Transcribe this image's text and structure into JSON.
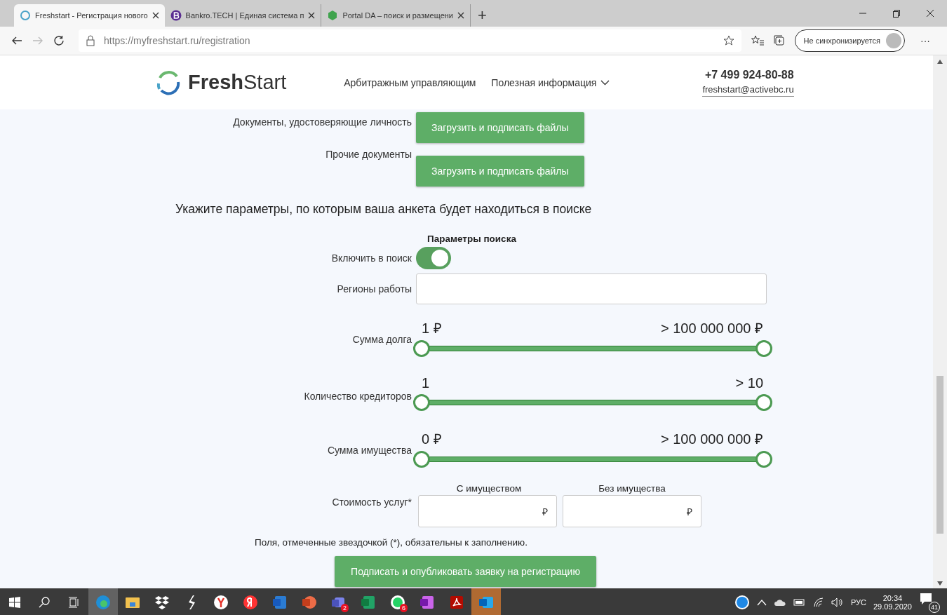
{
  "browser": {
    "tabs": [
      {
        "kind": "freshstart",
        "title": "Freshstart - Регистрация нового",
        "selected": true
      },
      {
        "kind": "bankro",
        "title": "Bankro.TECH | Единая система п",
        "selected": false
      },
      {
        "kind": "portal",
        "title": "Portal DA – поиск и размещени",
        "selected": false
      }
    ],
    "new_tab": "+",
    "url_host": "https://myfreshstart.ru",
    "url_path": "/registration",
    "profile_button": "Не синхронизируется",
    "more": "···"
  },
  "site_header": {
    "logo_bold": "Fresh",
    "logo_light": "Start",
    "nav": [
      {
        "label": "Арбитражным управляющим",
        "dropdown": false
      },
      {
        "label": "Полезная информация",
        "dropdown": true
      }
    ],
    "phone": "+7 499 924-80-88",
    "email": "freshstart@activebc.ru"
  },
  "documents": [
    {
      "label": "Документы, удостоверяющие личность",
      "button": "Загрузить и подписать файлы"
    },
    {
      "label": "Прочие документы",
      "button": "Загрузить и подписать файлы"
    }
  ],
  "search_params": {
    "heading": "Укажите параметры, по которым ваша анкета будет находиться в поиске",
    "subheading": "Параметры поиска",
    "include_label": "Включить в поиск",
    "include_on": true,
    "regions_label": "Регионы работы",
    "ranges": [
      {
        "label": "Сумма долга",
        "min_text": "1 ₽",
        "max_text": "> 100 000 000 ₽",
        "thumbs": [
          {
            "level": 0
          },
          {
            "level": 1
          }
        ]
      },
      {
        "label": "Количество кредиторов",
        "min_text": "1",
        "max_text": "> 10",
        "thumbs": [
          {
            "level": 0
          },
          {
            "level": 1
          }
        ]
      },
      {
        "label": "Сумма имущества",
        "min_text": "0 ₽",
        "max_text": "> 100 000 000 ₽",
        "thumbs": [
          {
            "level": 0
          },
          {
            "level": 1
          }
        ]
      }
    ],
    "cost_label": "Стоимость услуг*",
    "cost_fields": [
      {
        "header": "С имуществом",
        "currency": "₽"
      },
      {
        "header": "Без имущества",
        "currency": "₽"
      }
    ],
    "note": "Поля, отмеченные звездочкой (*), обязательны к заполнению.",
    "submit": "Подписать и опубликовать заявку на регистрацию"
  },
  "taskbar": {
    "apps": [
      {
        "kind": "edge",
        "selected": true
      },
      {
        "kind": "explorer",
        "selected": false
      },
      {
        "kind": "dropbox",
        "selected": false
      },
      {
        "kind": "slash",
        "selected": false
      },
      {
        "kind": "yandex-browser",
        "selected": false
      },
      {
        "kind": "yandex",
        "selected": false
      },
      {
        "kind": "word",
        "selected": false
      },
      {
        "kind": "powerpoint",
        "selected": false
      },
      {
        "kind": "teams",
        "selected": false,
        "badge": "2"
      },
      {
        "kind": "excel",
        "selected": false
      },
      {
        "kind": "whatsapp",
        "selected": false,
        "badge": "6"
      },
      {
        "kind": "onenote",
        "selected": false
      },
      {
        "kind": "acrobat",
        "selected": false
      },
      {
        "kind": "outlook",
        "selected": true
      }
    ],
    "language": "РУС",
    "time": "20:34",
    "date": "29.09.2020",
    "notifications": "41"
  }
}
